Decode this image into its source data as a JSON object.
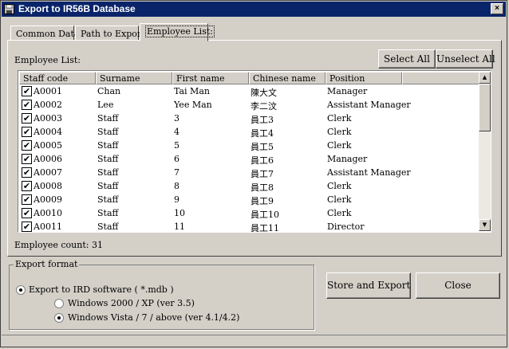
{
  "window": {
    "title": "Export to IR56B Database",
    "close_label": "×"
  },
  "tabs": [
    {
      "label": "Common Data"
    },
    {
      "label": "Path to Export"
    },
    {
      "label": "Employee List:"
    }
  ],
  "employee_panel": {
    "list_label": "Employee List:",
    "select_all_label": "Select All",
    "unselect_all_label": "Unselect All",
    "count_label": "Employee count: 31"
  },
  "table": {
    "columns": [
      "Staff code",
      "Surname",
      "First name",
      "Chinese name",
      "Position"
    ],
    "rows": [
      {
        "checked": true,
        "cells": [
          "A0001",
          "Chan",
          "Tai Man",
          "陳大文",
          "Manager"
        ]
      },
      {
        "checked": true,
        "cells": [
          "A0002",
          "Lee",
          "Yee Man",
          "李二汶",
          "Assistant Manager"
        ]
      },
      {
        "checked": true,
        "cells": [
          "A0003",
          "Staff",
          "3",
          "員工3",
          "Clerk"
        ]
      },
      {
        "checked": true,
        "cells": [
          "A0004",
          "Staff",
          "4",
          "員工4",
          "Clerk"
        ]
      },
      {
        "checked": true,
        "cells": [
          "A0005",
          "Staff",
          "5",
          "員工5",
          "Clerk"
        ]
      },
      {
        "checked": true,
        "cells": [
          "A0006",
          "Staff",
          "6",
          "員工6",
          "Manager"
        ]
      },
      {
        "checked": true,
        "cells": [
          "A0007",
          "Staff",
          "7",
          "員工7",
          "Assistant Manager"
        ]
      },
      {
        "checked": true,
        "cells": [
          "A0008",
          "Staff",
          "8",
          "員工8",
          "Clerk"
        ]
      },
      {
        "checked": true,
        "cells": [
          "A0009",
          "Staff",
          "9",
          "員工9",
          "Clerk"
        ]
      },
      {
        "checked": true,
        "cells": [
          "A0010",
          "Staff",
          "10",
          "員工10",
          "Clerk"
        ]
      },
      {
        "checked": true,
        "cells": [
          "A0011",
          "Staff",
          "11",
          "員工11",
          "Director"
        ]
      }
    ],
    "check_glyph": "✔"
  },
  "export_format": {
    "legend": "Export format",
    "main_option": "Export to IRD software ( *.mdb )",
    "option_xp": "Windows 2000 / XP (ver 3.5)",
    "option_vista": "Windows Vista / 7 / above (ver 4.1/4.2)",
    "main_selected": true,
    "selected_version": "vista"
  },
  "actions": {
    "store_export_label": "Store and Export",
    "close_label": "Close"
  },
  "icons": {
    "title": "floppy-disk-icon",
    "scroll_up": "arrow-up-icon",
    "scroll_down": "arrow-down-icon"
  }
}
